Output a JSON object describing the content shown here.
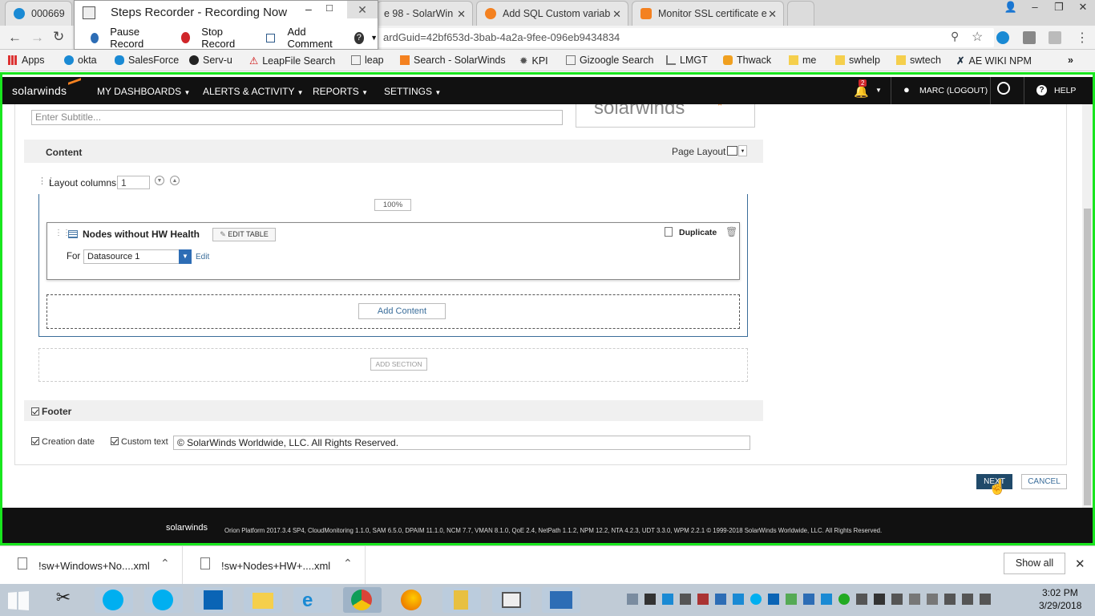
{
  "browser": {
    "tabs": [
      {
        "title": "000669"
      },
      {
        "title": "e 98 - SolarWin"
      },
      {
        "title": "Add SQL Custom variab"
      },
      {
        "title": "Monitor SSL certificate e"
      }
    ],
    "url": "ardGuid=42bf653d-3bab-4a2a-9fee-096eb9434834",
    "bookmarks": [
      "Apps",
      "okta",
      "SalesForce",
      "Serv-u",
      "LeapFile Search",
      "leap",
      "Search - SolarWinds",
      "KPI",
      "Gizoogle Search",
      "LMGT",
      "Thwack",
      "me",
      "swhelp",
      "swtech",
      "AE WIKI NPM"
    ]
  },
  "steps_recorder": {
    "title": "Steps Recorder - Recording Now",
    "pause": "Pause Record",
    "stop": "Stop Record",
    "comment": "Add Comment"
  },
  "nav": {
    "logo": "solarwinds",
    "items": [
      "MY DASHBOARDS",
      "ALERTS & ACTIVITY",
      "REPORTS",
      "SETTINGS"
    ],
    "notif_count": "2",
    "user": "MARC (LOGOUT)",
    "help": "HELP"
  },
  "report": {
    "subtitle_placeholder": "Enter Subtitle...",
    "logo_text": "solarwinds",
    "content_label": "Content",
    "page_layout_label": "Page Layout",
    "layout_columns_label": "Layout columns",
    "layout_columns_value": "1",
    "width_pct": "100%",
    "resource_title": "Nodes without HW Health",
    "edit_table": "EDIT TABLE",
    "duplicate": "Duplicate",
    "for_label": "For",
    "datasource": "Datasource 1",
    "edit_link": "Edit",
    "add_content": "Add Content",
    "add_section": "ADD SECTION",
    "footer_label": "Footer",
    "creation_date": "Creation date",
    "custom_text": "Custom text",
    "custom_text_value": "© SolarWinds Worldwide, LLC. All Rights Reserved.",
    "next": "NEXT",
    "cancel": "CANCEL"
  },
  "page_footer": {
    "logo": "solarwinds",
    "text": "Orion Platform 2017.3.4 SP4, CloudMonitoring 1.1.0, SAM 6.5.0, DPAIM 11.1.0, NCM 7.7, VMAN 8.1.0, QoE 2.4, NetPath 1.1.2, NPM 12.2, NTA 4.2.3, UDT 3.3.0, WPM 2.2.1 © 1999-2018 SolarWinds Worldwide, LLC. All Rights Reserved."
  },
  "downloads": {
    "items": [
      "!sw+Windows+No....xml",
      "!sw+Nodes+HW+....xml"
    ],
    "show_all": "Show all"
  },
  "taskbar": {
    "time": "3:02 PM",
    "date": "3/29/2018"
  },
  "colors": {
    "frame_border": "#19e61e",
    "nav_bg": "#111111",
    "next_btn": "#204a6a",
    "accent_orange": "#f48120"
  }
}
